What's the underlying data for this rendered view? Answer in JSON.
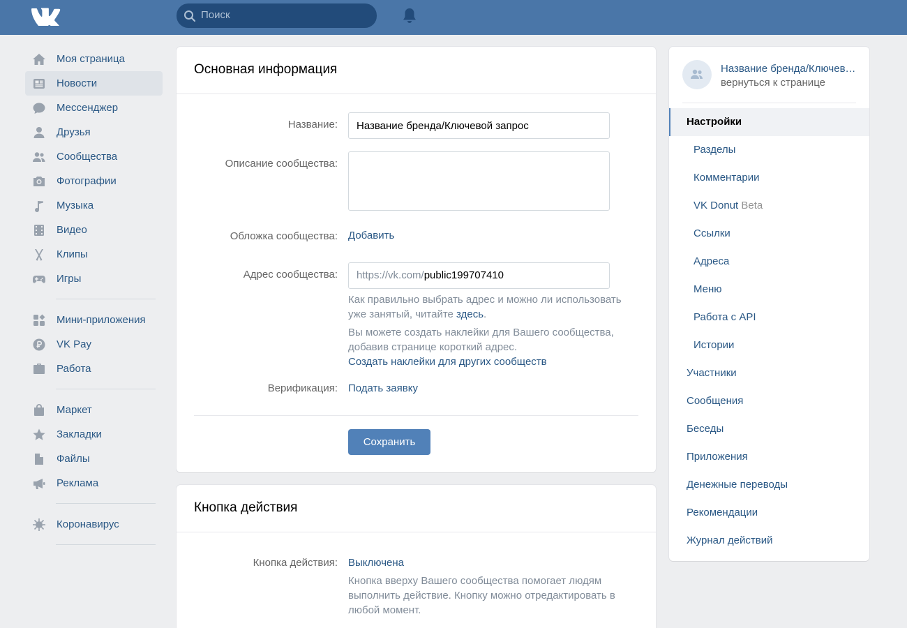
{
  "header": {
    "search_placeholder": "Поиск"
  },
  "sidebar": {
    "group1": [
      {
        "label": "Моя страница",
        "icon": "home-icon"
      },
      {
        "label": "Новости",
        "icon": "news-icon",
        "active": true
      },
      {
        "label": "Мессенджер",
        "icon": "messenger-icon"
      },
      {
        "label": "Друзья",
        "icon": "friends-icon"
      },
      {
        "label": "Сообщества",
        "icon": "communities-icon"
      },
      {
        "label": "Фотографии",
        "icon": "camera-icon"
      },
      {
        "label": "Музыка",
        "icon": "music-icon"
      },
      {
        "label": "Видео",
        "icon": "video-icon"
      },
      {
        "label": "Клипы",
        "icon": "clips-icon"
      },
      {
        "label": "Игры",
        "icon": "gamepad-icon"
      }
    ],
    "group2": [
      {
        "label": "Мини-приложения",
        "icon": "apps-icon"
      },
      {
        "label": "VK Pay",
        "icon": "ruble-icon"
      },
      {
        "label": "Работа",
        "icon": "briefcase-icon"
      }
    ],
    "group3": [
      {
        "label": "Маркет",
        "icon": "bag-icon"
      },
      {
        "label": "Закладки",
        "icon": "star-icon"
      },
      {
        "label": "Файлы",
        "icon": "file-icon"
      },
      {
        "label": "Реклама",
        "icon": "megaphone-icon"
      }
    ],
    "group4": [
      {
        "label": "Коронавирус",
        "icon": "virus-icon"
      }
    ]
  },
  "main": {
    "title": "Основная информация",
    "name_label": "Название:",
    "name_value": "Название бренда/Ключевой запрос",
    "desc_label": "Описание сообщества:",
    "desc_value": "",
    "cover_label": "Обложка сообщества:",
    "cover_link": "Добавить",
    "address_label": "Адрес сообщества:",
    "address_prefix": "https://vk.com/",
    "address_value": "public199707410",
    "hint1_text": "Как правильно выбрать адрес и можно ли использовать уже занятый, читайте ",
    "hint1_link": "здесь",
    "hint1_end": ".",
    "hint2_text": "Вы можете создать наклейки для Вашего сообщества, добавив странице короткий адрес.",
    "hint2_link": "Создать наклейки для других сообществ",
    "verify_label": "Верификация:",
    "verify_link": "Подать заявку",
    "save_label": "Сохранить"
  },
  "action_card": {
    "title": "Кнопка действия",
    "label": "Кнопка действия:",
    "value": "Выключена",
    "hint": "Кнопка вверху Вашего сообщества помогает людям выполнить действие. Кнопку можно отредактировать в любой момент."
  },
  "right_menu": {
    "group_name": "Название бренда/Ключевой запрос",
    "back_label": "вернуться к странице",
    "items": [
      {
        "label": "Настройки",
        "active": true,
        "sub": false
      },
      {
        "label": "Разделы",
        "sub": true
      },
      {
        "label": "Комментарии",
        "sub": true
      },
      {
        "label": "VK Donut",
        "beta": "Beta",
        "sub": true
      },
      {
        "label": "Ссылки",
        "sub": true
      },
      {
        "label": "Адреса",
        "sub": true
      },
      {
        "label": "Меню",
        "sub": true
      },
      {
        "label": "Работа с API",
        "sub": true
      },
      {
        "label": "Истории",
        "sub": true
      },
      {
        "label": "Участники",
        "sub": false
      },
      {
        "label": "Сообщения",
        "sub": false
      },
      {
        "label": "Беседы",
        "sub": false
      },
      {
        "label": "Приложения",
        "sub": false
      },
      {
        "label": "Денежные переводы",
        "sub": false
      },
      {
        "label": "Рекомендации",
        "sub": false
      },
      {
        "label": "Журнал действий",
        "sub": false
      }
    ]
  },
  "colors": {
    "header": "#4a76a8",
    "link": "#2a5885",
    "icon": "#99a2ad",
    "button": "#5181b8"
  }
}
